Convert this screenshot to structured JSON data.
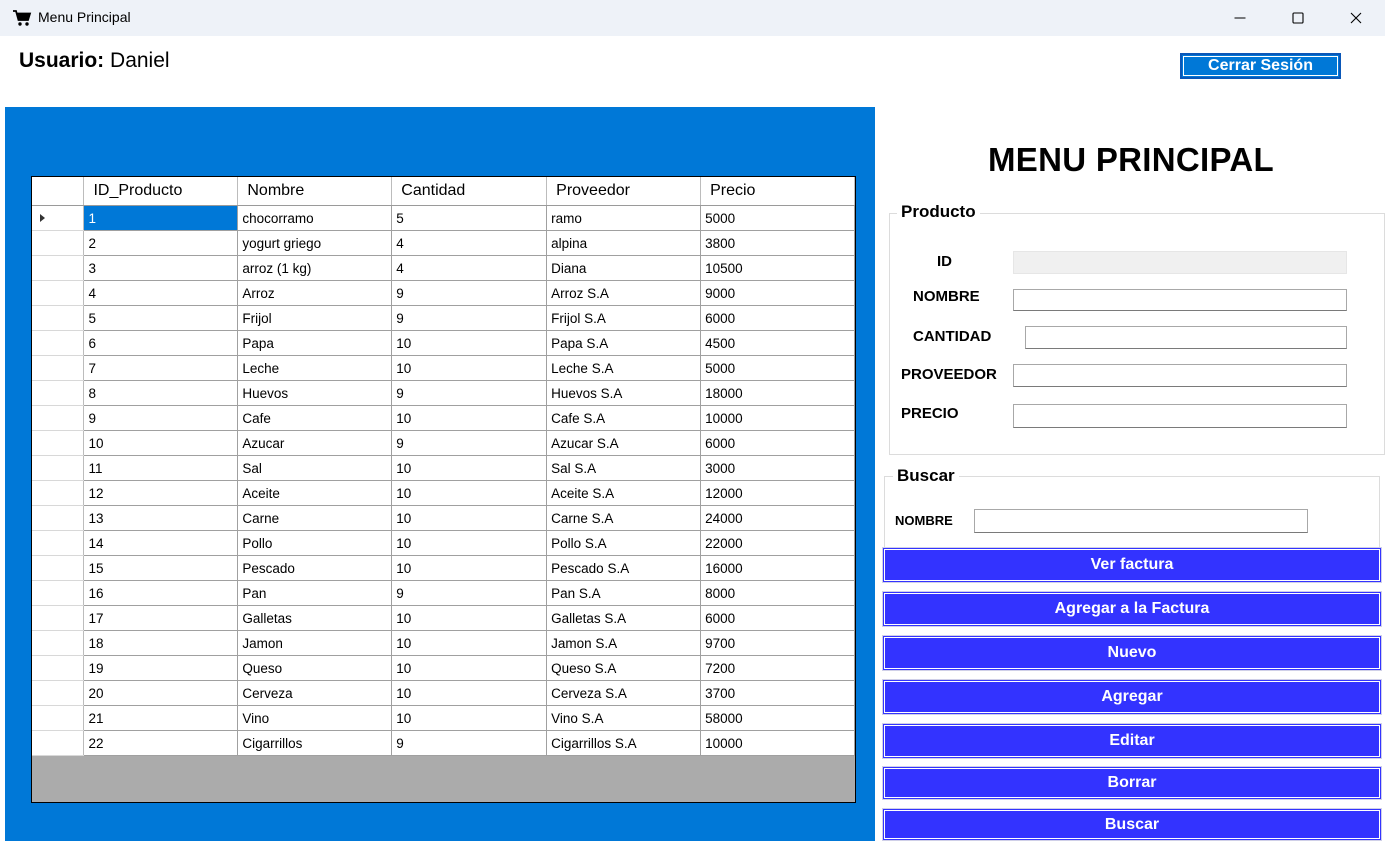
{
  "window": {
    "title": "Menu Principal"
  },
  "user": {
    "label": "Usuario:",
    "name": "Daniel"
  },
  "logout_button": "Cerrar Sesión",
  "main_title": "MENU PRINCIPAL",
  "product_group": {
    "title": "Producto",
    "fields": [
      {
        "label": "ID",
        "value": ""
      },
      {
        "label": "NOMBRE",
        "value": ""
      },
      {
        "label": "CANTIDAD",
        "value": ""
      },
      {
        "label": "PROVEEDOR",
        "value": ""
      },
      {
        "label": "PRECIO",
        "value": ""
      }
    ]
  },
  "search_group": {
    "title": "Buscar",
    "label": "NOMBRE",
    "value": ""
  },
  "buttons": [
    "Ver factura",
    "Agregar a la Factura",
    "Nuevo",
    "Agregar",
    "Editar",
    "Borrar",
    "Buscar"
  ],
  "table": {
    "columns": [
      "ID_Producto",
      "Nombre",
      "Cantidad",
      "Proveedor",
      "Precio"
    ],
    "selected_index": 0,
    "rows": [
      [
        "1",
        "chocorramo",
        "5",
        "ramo",
        "5000"
      ],
      [
        "2",
        "yogurt griego",
        "4",
        "alpina",
        "3800"
      ],
      [
        "3",
        "arroz (1 kg)",
        "4",
        "Diana",
        "10500"
      ],
      [
        "4",
        "Arroz",
        "9",
        "Arroz S.A",
        "9000"
      ],
      [
        "5",
        "Frijol",
        "9",
        "Frijol S.A",
        "6000"
      ],
      [
        "6",
        "Papa",
        "10",
        "Papa S.A",
        "4500"
      ],
      [
        "7",
        "Leche",
        "10",
        "Leche S.A",
        "5000"
      ],
      [
        "8",
        "Huevos",
        "9",
        "Huevos S.A",
        "18000"
      ],
      [
        "9",
        "Cafe",
        "10",
        "Cafe S.A",
        "10000"
      ],
      [
        "10",
        "Azucar",
        "9",
        "Azucar S.A",
        "6000"
      ],
      [
        "11",
        "Sal",
        "10",
        "Sal S.A",
        "3000"
      ],
      [
        "12",
        "Aceite",
        "10",
        "Aceite S.A",
        "12000"
      ],
      [
        "13",
        "Carne",
        "10",
        "Carne S.A",
        "24000"
      ],
      [
        "14",
        "Pollo",
        "10",
        "Pollo S.A",
        "22000"
      ],
      [
        "15",
        "Pescado",
        "10",
        "Pescado S.A",
        "16000"
      ],
      [
        "16",
        "Pan",
        "9",
        "Pan S.A",
        "8000"
      ],
      [
        "17",
        "Galletas",
        "10",
        "Galletas S.A",
        "6000"
      ],
      [
        "18",
        "Jamon",
        "10",
        "Jamon S.A",
        "9700"
      ],
      [
        "19",
        "Queso",
        "10",
        "Queso S.A",
        "7200"
      ],
      [
        "20",
        "Cerveza",
        "10",
        "Cerveza S.A",
        "3700"
      ],
      [
        "21",
        "Vino",
        "10",
        "Vino S.A",
        "58000"
      ],
      [
        "22",
        "Cigarrillos",
        "9",
        "Cigarrillos S.A",
        "10000"
      ]
    ]
  },
  "icons": {
    "app": "shopping-cart-icon",
    "minimize": "minimize-icon",
    "maximize": "maximize-icon",
    "close": "close-icon",
    "row_pointer": "row-pointer-icon"
  },
  "colors": {
    "panel_blue": "#0078d7",
    "button_blue": "#3333ff",
    "grid_empty": "#ababab"
  }
}
